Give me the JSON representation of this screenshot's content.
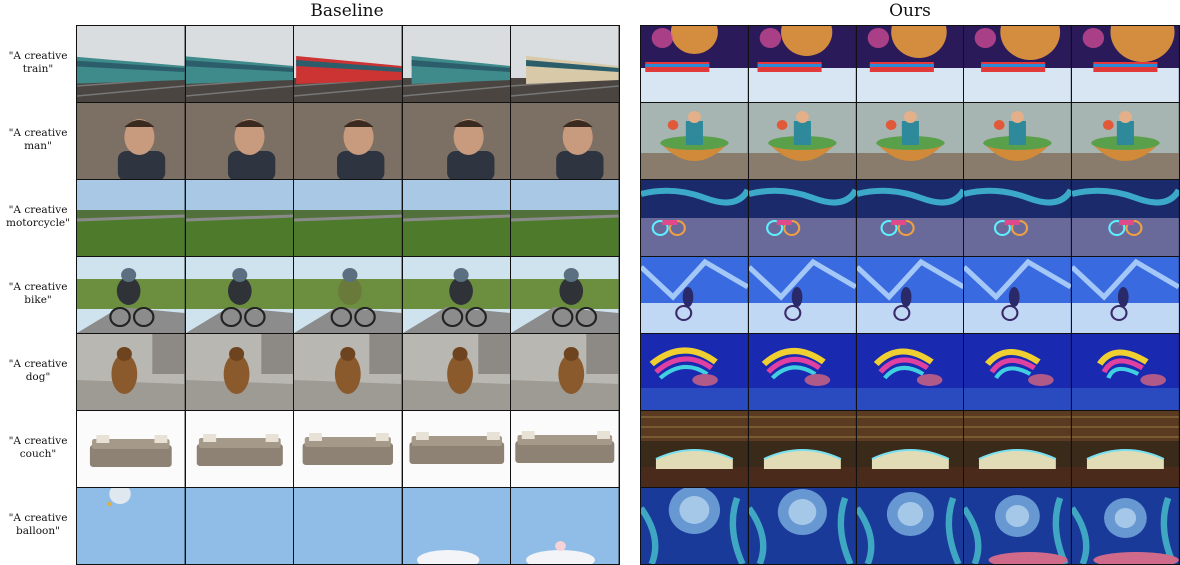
{
  "headers": {
    "baseline": "Baseline",
    "ours": "Ours"
  },
  "rows": [
    {
      "label": "\"A creative\ntrain\"",
      "subject": "train"
    },
    {
      "label": "\"A creative\nman\"",
      "subject": "man"
    },
    {
      "label": "\"A creative\nmotorcycle\"",
      "subject": "motorcycle"
    },
    {
      "label": "\"A creative\nbike\"",
      "subject": "bike"
    },
    {
      "label": "\"A creative\ndog\"",
      "subject": "dog"
    },
    {
      "label": "\"A creative\ncouch\"",
      "subject": "couch"
    },
    {
      "label": "\"A creative\nballoon\"",
      "subject": "balloon"
    }
  ],
  "frames_per_row": 5
}
